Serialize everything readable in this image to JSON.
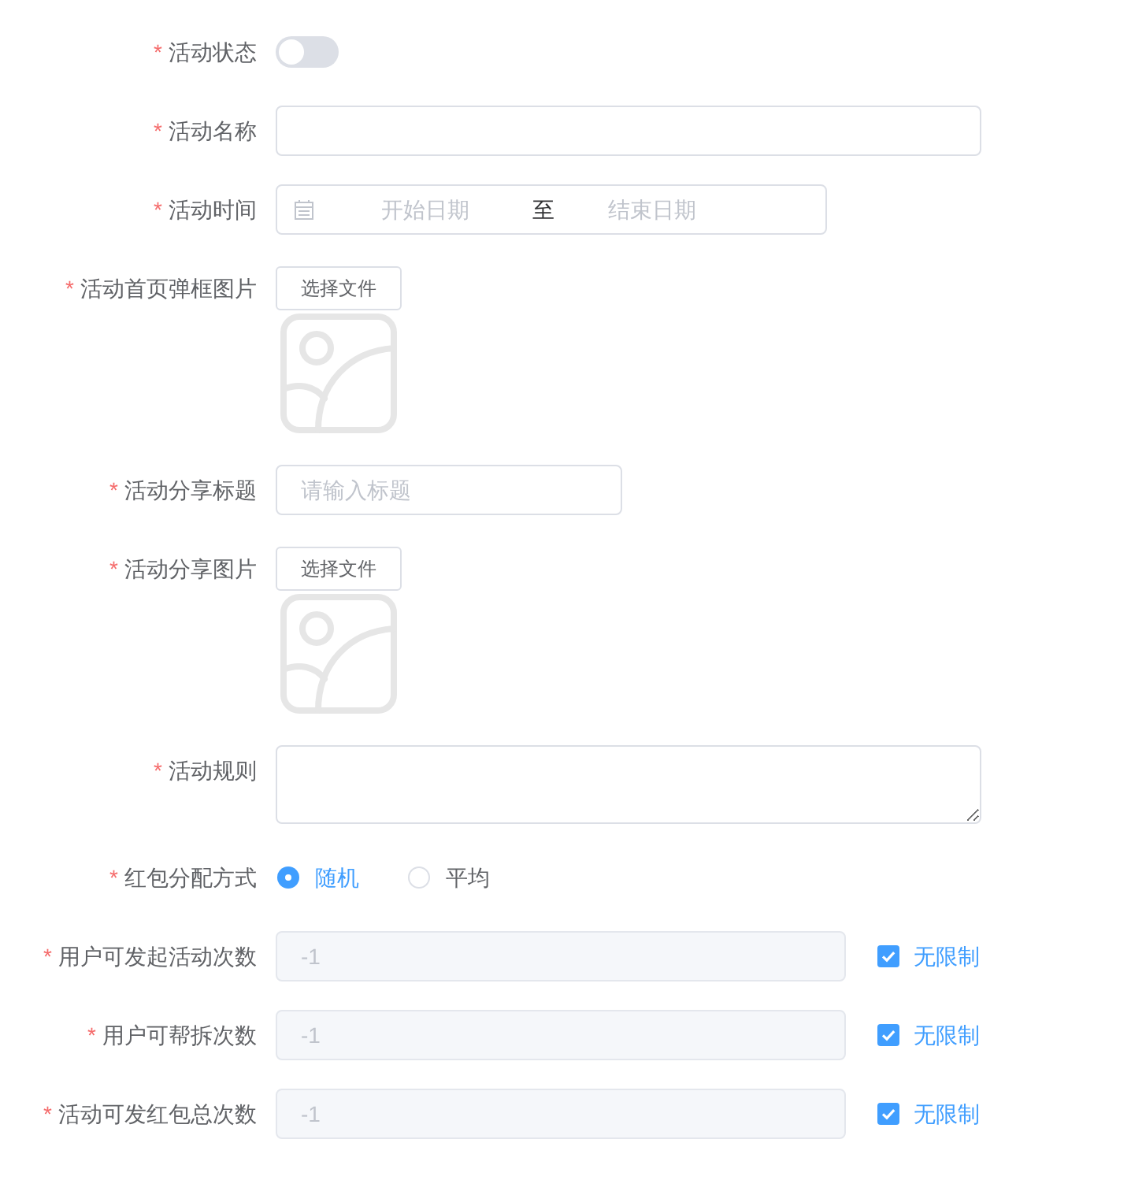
{
  "form": {
    "items": [
      {
        "kind": "switch",
        "mark": "*",
        "label": "活动状态",
        "on": false
      },
      {
        "kind": "input",
        "mark": "*",
        "label": "活动名称"
      },
      {
        "kind": "daterange",
        "mark": "*",
        "label": "活动时间",
        "start_placeholder": "开始日期",
        "separator": "至",
        "end_placeholder": "结束日期"
      },
      {
        "kind": "upload",
        "mark": "*",
        "label": "活动首页弹框图片",
        "button": "选择文件"
      },
      {
        "kind": "shortinput",
        "mark": "*",
        "label": "活动分享标题",
        "placeholder": "请输入标题"
      },
      {
        "kind": "upload",
        "mark": "*",
        "label": "活动分享图片",
        "button": "选择文件"
      },
      {
        "kind": "textarea",
        "mark": "*",
        "label": "活动规则"
      },
      {
        "kind": "radio",
        "mark": "*",
        "label": "红包分配方式",
        "options": [
          {
            "label": "随机",
            "selected": true
          },
          {
            "label": "平均",
            "selected": false
          }
        ]
      },
      {
        "kind": "limit",
        "mark": "*",
        "label": "用户可发起活动次数",
        "value": "-1",
        "disabled": true,
        "checkbox": {
          "label": "无限制",
          "checked": true
        }
      },
      {
        "kind": "limit",
        "mark": "*",
        "label": "用户可帮拆次数",
        "value": "-1",
        "disabled": true,
        "checkbox": {
          "label": "无限制",
          "checked": true
        }
      },
      {
        "kind": "limit",
        "mark": "*",
        "label": "活动可发红包总次数",
        "value": "-1",
        "disabled": true,
        "checkbox": {
          "label": "无限制",
          "checked": true
        }
      }
    ]
  }
}
